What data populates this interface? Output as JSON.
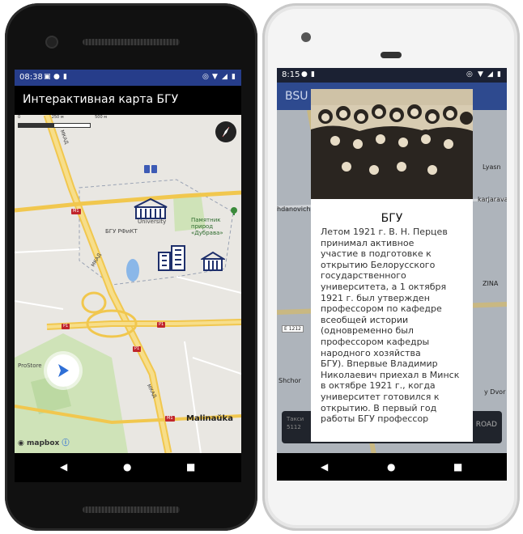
{
  "phone1": {
    "status": {
      "time": "08:38"
    },
    "app_title": "Интерактивная карта БГУ",
    "map": {
      "scale_labels": [
        "0",
        "250 м",
        "500 м"
      ],
      "labels": {
        "university": "University",
        "bgu_rfict": "БГУ РФиКТ",
        "park": "Памятник природ «Дубрава»",
        "prostore": "ProStore",
        "malinauka": "Malinaŭka",
        "mkad1": "МКАД",
        "mkad2": "МКАД",
        "mkad3": "МКАД",
        "m1a": "M1",
        "m1b": "M1",
        "p1a": "P1",
        "p1b": "P1",
        "p1c": "P1"
      },
      "attribution": "mapbox"
    }
  },
  "phone2": {
    "status": {
      "time": "8:15"
    },
    "app_title": "BSU",
    "map_labels": {
      "lyasn": "Lyasn",
      "hdanovich": "hdanovich",
      "karjarava": "karjarava",
      "zina": "ZINA",
      "e1212": "E 1212",
      "shchor": "Shchor",
      "y_dvor": "y Dvor"
    },
    "bottom_card": {
      "l1": "Такси",
      "l2": "5112",
      "road": "ROAD"
    },
    "dialog": {
      "title": "БГУ",
      "body": [
        "Летом 1921 г. В. Н. Перцев",
        "принимал активное",
        "участие в подготовке к",
        "открытию Белорусского",
        "государственного",
        "университета, а 1 октября",
        "1921 г. был утвержден",
        "профессором по кафедре",
        "всеобщей истории",
        "(одновременно был",
        "профессором кафедры",
        "народного хозяйства",
        "БГУ). Впервые Владимир",
        "Николаевич приехал в Минск",
        "в октябре 1921 г., когда",
        "университет готовился к",
        "открытию. В первый год",
        "работы БГУ профессор"
      ]
    }
  },
  "colors": {
    "status_bar": "#263d8a",
    "appbar": "#000000",
    "road_tag": "#c0262c",
    "bsu_bar": "#2e4a8f"
  }
}
